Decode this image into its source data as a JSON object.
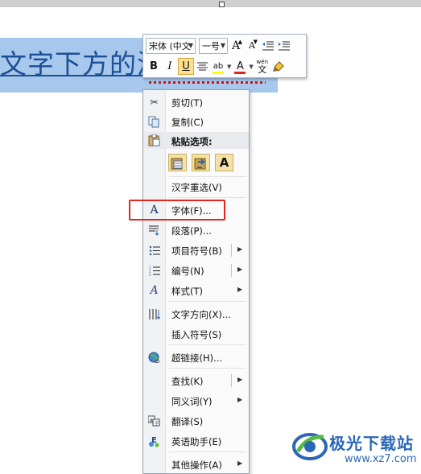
{
  "document": {
    "selected_text": "文字下方的波浪线"
  },
  "mini_toolbar": {
    "font_name": "宋体 (中文",
    "font_size": "一号",
    "grow_font": "A",
    "shrink_font": "A",
    "bold": "B",
    "italic": "I",
    "underline": "U",
    "font_color_letter": "A",
    "phonetic": "wén",
    "phonetic_char": "文",
    "highlight_color": "#ffff00",
    "font_color": "#e3261f"
  },
  "context_menu": {
    "cut": "剪切(T)",
    "copy": "复制(C)",
    "paste_options": "粘贴选项:",
    "reconvert": "汉字重选(V)",
    "font": "字体(F)...",
    "paragraph": "段落(P)...",
    "bullets": "项目符号(B)",
    "numbering": "编号(N)",
    "styles": "样式(T)",
    "text_direction": "文字方向(X)...",
    "insert_symbol": "插入符号(S)",
    "hyperlink": "超链接(H)...",
    "find": "查找(K)",
    "synonyms": "同义词(Y)",
    "translate": "翻译(S)",
    "english_assistant": "英语助手(E)",
    "more_actions": "其他操作(A)",
    "paste_keep_text": "A"
  },
  "watermark": {
    "title": "极光下载站",
    "url": "www.xz7.com"
  },
  "colors": {
    "selection": "#a7c8ec",
    "highlight_frame": "#e3261f",
    "watermark": "#2a67b6"
  }
}
